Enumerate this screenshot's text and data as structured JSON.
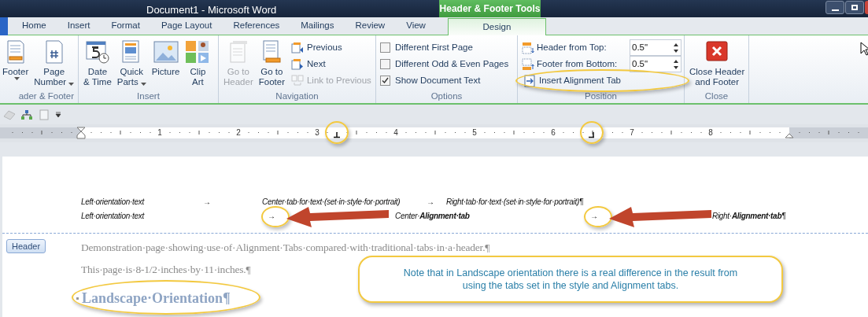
{
  "window": {
    "title": "Document1  -  Microsoft Word",
    "contextual_tab": "Header & Footer Tools"
  },
  "tabs": [
    {
      "label": "Home",
      "selected": false
    },
    {
      "label": "Insert",
      "selected": false
    },
    {
      "label": "Format",
      "selected": false
    },
    {
      "label": "Page Layout",
      "selected": false
    },
    {
      "label": "References",
      "selected": false
    },
    {
      "label": "Mailings",
      "selected": false
    },
    {
      "label": "Review",
      "selected": false
    },
    {
      "label": "View",
      "selected": false
    },
    {
      "label": "Design",
      "selected": true
    }
  ],
  "ribbon": {
    "groups": [
      {
        "label": "ader & Footer",
        "items": [
          {
            "kind": "large",
            "lines": [
              "Footer"
            ],
            "dropdown": true,
            "disabled": false
          },
          {
            "kind": "large",
            "lines": [
              "Page",
              "Number"
            ],
            "dropdown": true,
            "disabled": false
          }
        ]
      },
      {
        "label": "Insert",
        "items": [
          {
            "kind": "large",
            "lines": [
              "Date",
              "& Time"
            ],
            "dropdown": false,
            "disabled": false
          },
          {
            "kind": "large",
            "lines": [
              "Quick",
              "Parts"
            ],
            "dropdown": true,
            "disabled": false
          },
          {
            "kind": "large",
            "lines": [
              "Picture"
            ],
            "dropdown": false,
            "disabled": false
          },
          {
            "kind": "large",
            "lines": [
              "Clip",
              "Art"
            ],
            "dropdown": false,
            "disabled": false
          }
        ]
      },
      {
        "label": "Navigation",
        "items": [
          {
            "kind": "large",
            "lines": [
              "Go to",
              "Header"
            ],
            "dropdown": false,
            "disabled": true
          },
          {
            "kind": "large",
            "lines": [
              "Go to",
              "Footer"
            ],
            "dropdown": false,
            "disabled": false
          },
          {
            "kind": "small",
            "label": "Previous",
            "disabled": false
          },
          {
            "kind": "small",
            "label": "Next",
            "disabled": false
          },
          {
            "kind": "small",
            "label": "Link to Previous",
            "disabled": true
          }
        ]
      },
      {
        "label": "Options",
        "items": [
          {
            "kind": "checkbox",
            "label": "Different First Page",
            "checked": false
          },
          {
            "kind": "checkbox",
            "label": "Different Odd & Even Pages",
            "checked": false
          },
          {
            "kind": "checkbox",
            "label": "Show Document Text",
            "checked": true
          }
        ]
      },
      {
        "label": "Position",
        "items": [
          {
            "kind": "spinner",
            "label": "Header from Top:",
            "value": "0.5\""
          },
          {
            "kind": "spinner",
            "label": "Footer from Bottom:",
            "value": "0.5\""
          },
          {
            "kind": "small",
            "label": "Insert Alignment Tab",
            "disabled": false,
            "circled": true
          }
        ]
      },
      {
        "label": "Close",
        "items": [
          {
            "kind": "large",
            "lines": [
              "Close Header",
              "and Footer"
            ],
            "dropdown": false,
            "disabled": false
          }
        ]
      }
    ]
  },
  "ruler": {
    "numbers": [
      "1",
      "2",
      "3",
      "4",
      "5",
      "6",
      "7",
      "8"
    ],
    "tab_stops": [
      {
        "kind": "center",
        "level": 0.388,
        "circled": true
      },
      {
        "kind": "right",
        "level": 0.682,
        "circled": true
      }
    ]
  },
  "header_lines": [
    [
      {
        "kind": "text",
        "text": "Left·orientation·text"
      },
      {
        "kind": "tab",
        "text": "→",
        "circled": false
      },
      {
        "kind": "text",
        "text": "Center·tab·for·text·(set·in·style·for·portrait)"
      },
      {
        "kind": "tab",
        "text": "→",
        "circled": false
      },
      {
        "kind": "text",
        "text": "Right·tab·for·text·(set·in·style·for·portrait)¶"
      }
    ],
    [
      {
        "kind": "text",
        "text": "Left·orientation·text"
      },
      {
        "kind": "tab",
        "text": "→",
        "circled": true
      },
      {
        "kind": "text",
        "text": "Center·**Alignment·tab**"
      },
      {
        "kind": "tab",
        "text": "→",
        "circled": true
      },
      {
        "kind": "text",
        "text": "Right·**Alignment·tab**¶"
      }
    ]
  ],
  "header_tag": "Header",
  "body": [
    {
      "kind": "paragraph",
      "text": "Demonstration·page·showing·use·of·Alignment·Tabs·compared·with·traditional·tabs·in·a·header.¶",
      "circled": false
    },
    {
      "kind": "paragraph",
      "text": "This·page·is·8-1/2·inches·by·11·inches.¶",
      "circled": false
    },
    {
      "kind": "heading",
      "text": "Landscape·Orientation¶",
      "circled": true
    }
  ],
  "callout": "Note that in Landscape orientation there is a real difference in the result from using the tabs set in the style and Alignment tabs."
}
